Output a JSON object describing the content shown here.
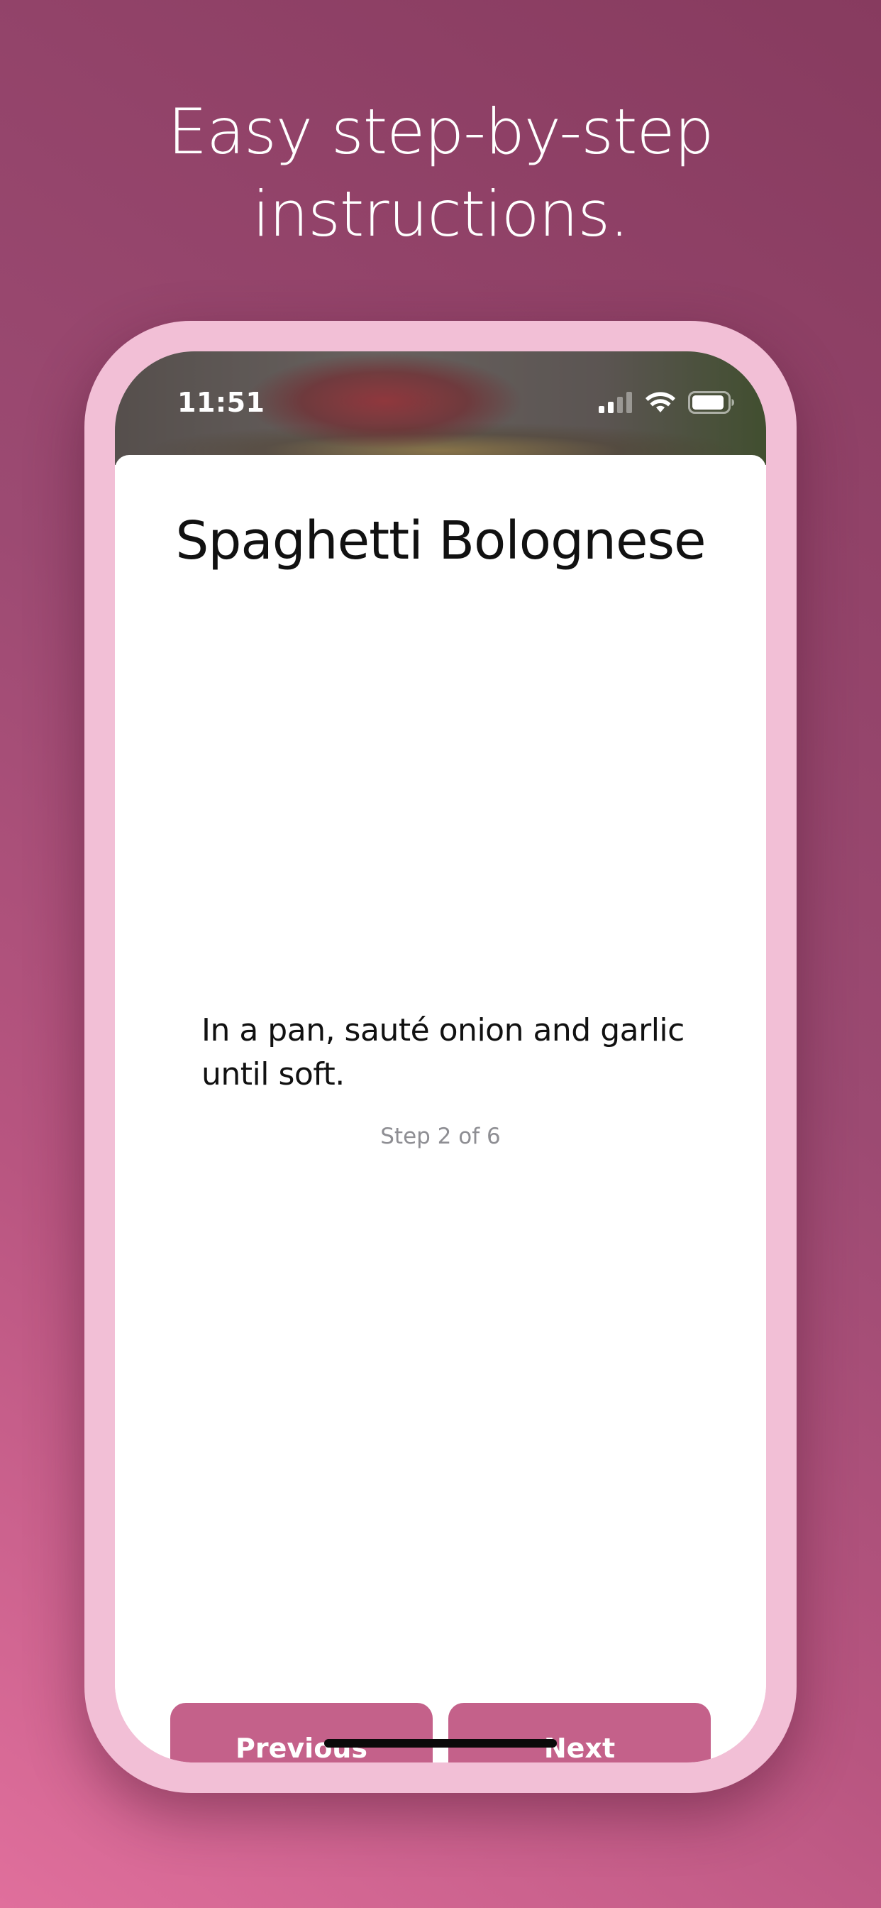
{
  "promo": {
    "headline_line1": "Easy step-by-step",
    "headline_line2": "instructions."
  },
  "status_bar": {
    "time": "11:51",
    "icons": [
      "cellular-signal-icon",
      "wifi-icon",
      "battery-icon"
    ],
    "signal_bars_active": 2,
    "signal_bars_total": 4,
    "battery_level": 0.85
  },
  "recipe": {
    "title": "Spaghetti Bolognese",
    "current_step_text": "In a pan, sauté onion and garlic until soft.",
    "step_counter": "Step 2 of 6",
    "current_step": 2,
    "total_steps": 6
  },
  "navigation": {
    "previous_label": "Previous",
    "next_label": "Next"
  },
  "colors": {
    "accent": "#c4618a",
    "frame": "#f2bfd6",
    "counter_text": "#8e8e93"
  }
}
